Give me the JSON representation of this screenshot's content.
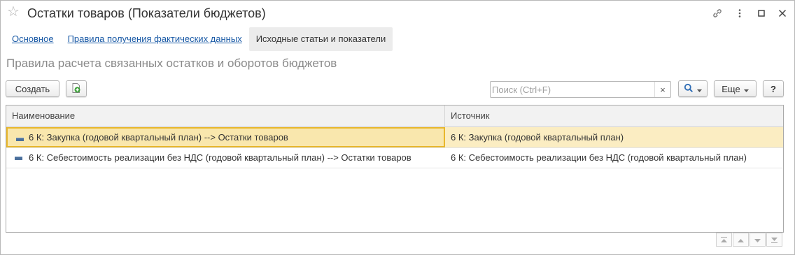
{
  "window": {
    "title": "Остатки товаров (Показатели бюджетов)",
    "icons": [
      "star-icon",
      "link-icon",
      "more-icon",
      "maximize-icon",
      "close-icon"
    ]
  },
  "tabs": [
    {
      "label": "Основное",
      "active": false
    },
    {
      "label": "Правила получения фактических данных",
      "active": false
    },
    {
      "label": "Исходные статьи и показатели",
      "active": true
    }
  ],
  "section_title": "Правила расчета связанных остатков и оборотов бюджетов",
  "toolbar": {
    "create_label": "Создать",
    "search_placeholder": "Поиск (Ctrl+F)",
    "clear_symbol": "×",
    "more_label": "Еще",
    "help_label": "?"
  },
  "table": {
    "columns": [
      "Наименование",
      "Источник"
    ],
    "rows": [
      {
        "name": "6 К: Закупка (годовой квартальный план) --> Остатки товаров",
        "source": "6 К: Закупка (годовой квартальный план)",
        "selected": true
      },
      {
        "name": "6 К: Себестоимость реализации без НДС (годовой квартальный план) --> Остатки товаров",
        "source": "6 К: Себестоимость реализации без НДС (годовой квартальный план)",
        "selected": false
      }
    ]
  },
  "colors": {
    "link": "#1a5aa6",
    "selected_row": "#fbedc2",
    "selected_border": "#e8b72c",
    "add_icon": "#3aa037"
  }
}
